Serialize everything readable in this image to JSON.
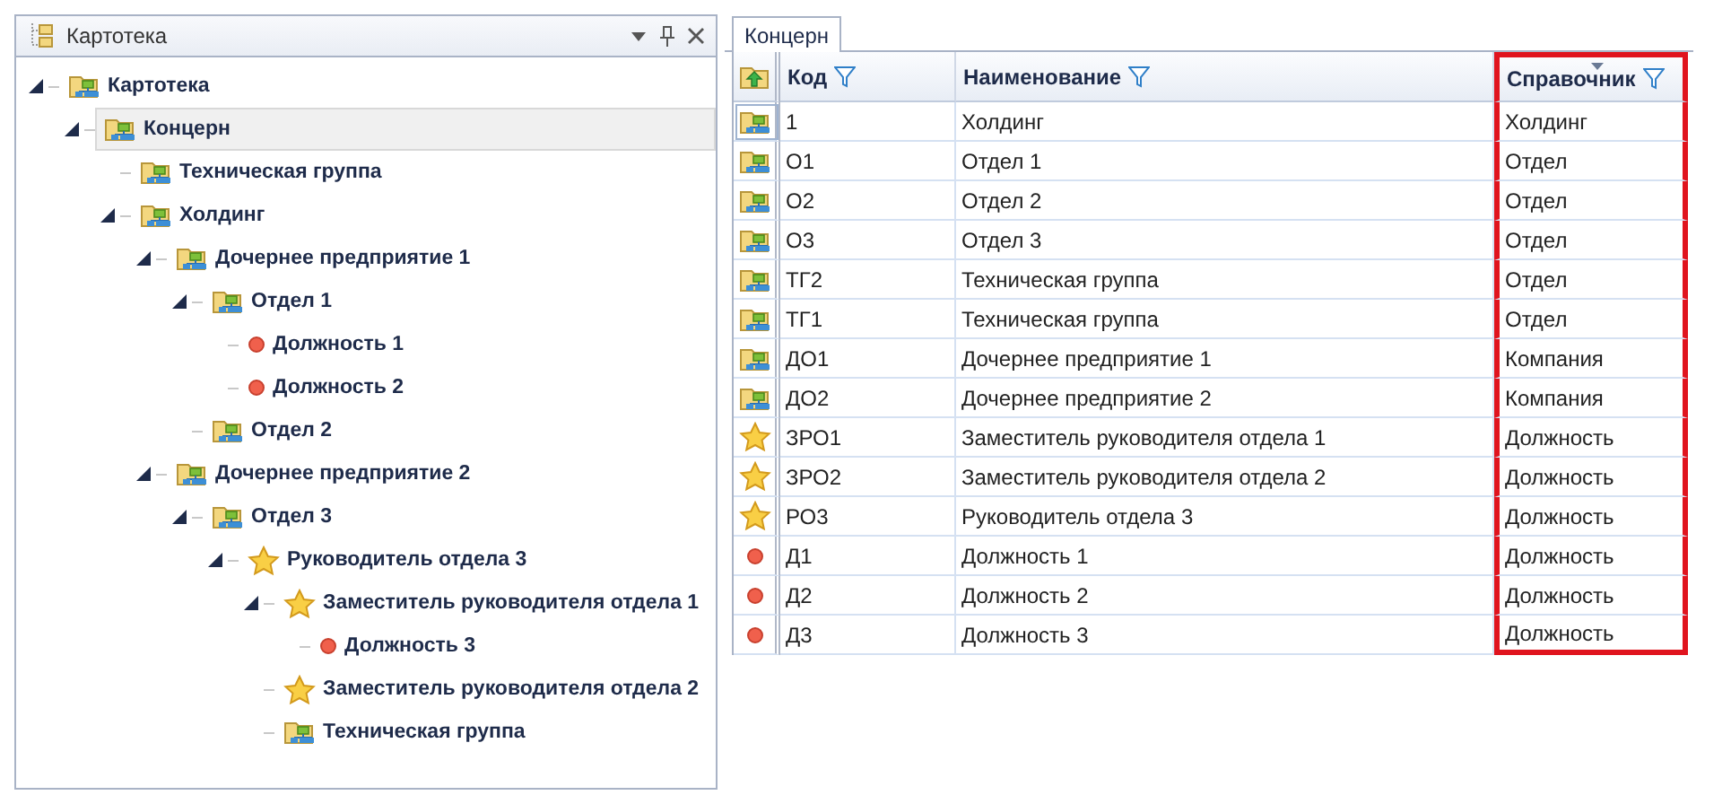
{
  "tree_pane": {
    "title": "Картотека",
    "tree": [
      {
        "label": "Картотека",
        "kind": "folder",
        "selected": false,
        "expanded": true,
        "children": [
          {
            "label": "Концерн",
            "kind": "folder",
            "selected": true,
            "expanded": true,
            "children": [
              {
                "label": "Техническая группа",
                "kind": "folder",
                "selected": false
              },
              {
                "label": "Холдинг",
                "kind": "folder",
                "selected": false,
                "expanded": true,
                "children": [
                  {
                    "label": "Дочернее предприятие 1",
                    "kind": "folder",
                    "selected": false,
                    "expanded": true,
                    "children": [
                      {
                        "label": "Отдел 1",
                        "kind": "folder",
                        "selected": false,
                        "expanded": true,
                        "children": [
                          {
                            "label": "Должность 1",
                            "kind": "dot",
                            "selected": false
                          },
                          {
                            "label": "Должность 2",
                            "kind": "dot",
                            "selected": false
                          }
                        ]
                      },
                      {
                        "label": "Отдел 2",
                        "kind": "folder",
                        "selected": false
                      }
                    ]
                  },
                  {
                    "label": "Дочернее предприятие 2",
                    "kind": "folder",
                    "selected": false,
                    "expanded": true,
                    "children": [
                      {
                        "label": "Отдел 3",
                        "kind": "folder",
                        "selected": false,
                        "expanded": true,
                        "children": [
                          {
                            "label": "Руководитель отдела 3",
                            "kind": "star",
                            "selected": false,
                            "expanded": true,
                            "children": [
                              {
                                "label": "Заместитель руководителя отдела 1",
                                "kind": "star",
                                "selected": false,
                                "expanded": true,
                                "children": [
                                  {
                                    "label": "Должность 3",
                                    "kind": "dot",
                                    "selected": false
                                  }
                                ]
                              },
                              {
                                "label": "Заместитель руководителя отдела 2",
                                "kind": "star",
                                "selected": false
                              },
                              {
                                "label": "Техническая группа",
                                "kind": "folder",
                                "selected": false
                              }
                            ]
                          }
                        ]
                      }
                    ]
                  }
                ]
              }
            ]
          }
        ]
      }
    ]
  },
  "grid_pane": {
    "tabs": [
      {
        "label": "Концерн",
        "selected": true
      }
    ],
    "columns": [
      {
        "label": "Код",
        "sorted": false,
        "highlighted": false
      },
      {
        "label": "Наименование",
        "sorted": false,
        "highlighted": false
      },
      {
        "label": "Справочник",
        "sorted": true,
        "highlighted": true
      }
    ],
    "rows": [
      {
        "kind": "folder",
        "selected": true,
        "cells": [
          "1",
          "Холдинг",
          "Холдинг"
        ]
      },
      {
        "kind": "folder",
        "selected": false,
        "cells": [
          "О1",
          "Отдел 1",
          "Отдел"
        ]
      },
      {
        "kind": "folder",
        "selected": false,
        "cells": [
          "О2",
          "Отдел 2",
          "Отдел"
        ]
      },
      {
        "kind": "folder",
        "selected": false,
        "cells": [
          "О3",
          "Отдел 3",
          "Отдел"
        ]
      },
      {
        "kind": "folder",
        "selected": false,
        "cells": [
          "ТГ2",
          "Техническая группа",
          "Отдел"
        ]
      },
      {
        "kind": "folder",
        "selected": false,
        "cells": [
          "ТГ1",
          "Техническая группа",
          "Отдел"
        ]
      },
      {
        "kind": "folder",
        "selected": false,
        "cells": [
          "ДО1",
          "Дочернее предприятие 1",
          "Компания"
        ]
      },
      {
        "kind": "folder",
        "selected": false,
        "cells": [
          "ДО2",
          "Дочернее предприятие 2",
          "Компания"
        ]
      },
      {
        "kind": "star",
        "selected": false,
        "cells": [
          "ЗРО1",
          "Заместитель руководителя отдела 1",
          "Должность"
        ]
      },
      {
        "kind": "star",
        "selected": false,
        "cells": [
          "ЗРО2",
          "Заместитель руководителя отдела 2",
          "Должность"
        ]
      },
      {
        "kind": "star",
        "selected": false,
        "cells": [
          "РО3",
          "Руководитель отдела 3",
          "Должность"
        ]
      },
      {
        "kind": "dot",
        "selected": false,
        "cells": [
          "Д1",
          "Должность 1",
          "Должность"
        ]
      },
      {
        "kind": "dot",
        "selected": false,
        "cells": [
          "Д2",
          "Должность 2",
          "Должность"
        ]
      },
      {
        "kind": "dot",
        "selected": false,
        "cells": [
          "Д3",
          "Должность 3",
          "Должность"
        ]
      }
    ]
  }
}
